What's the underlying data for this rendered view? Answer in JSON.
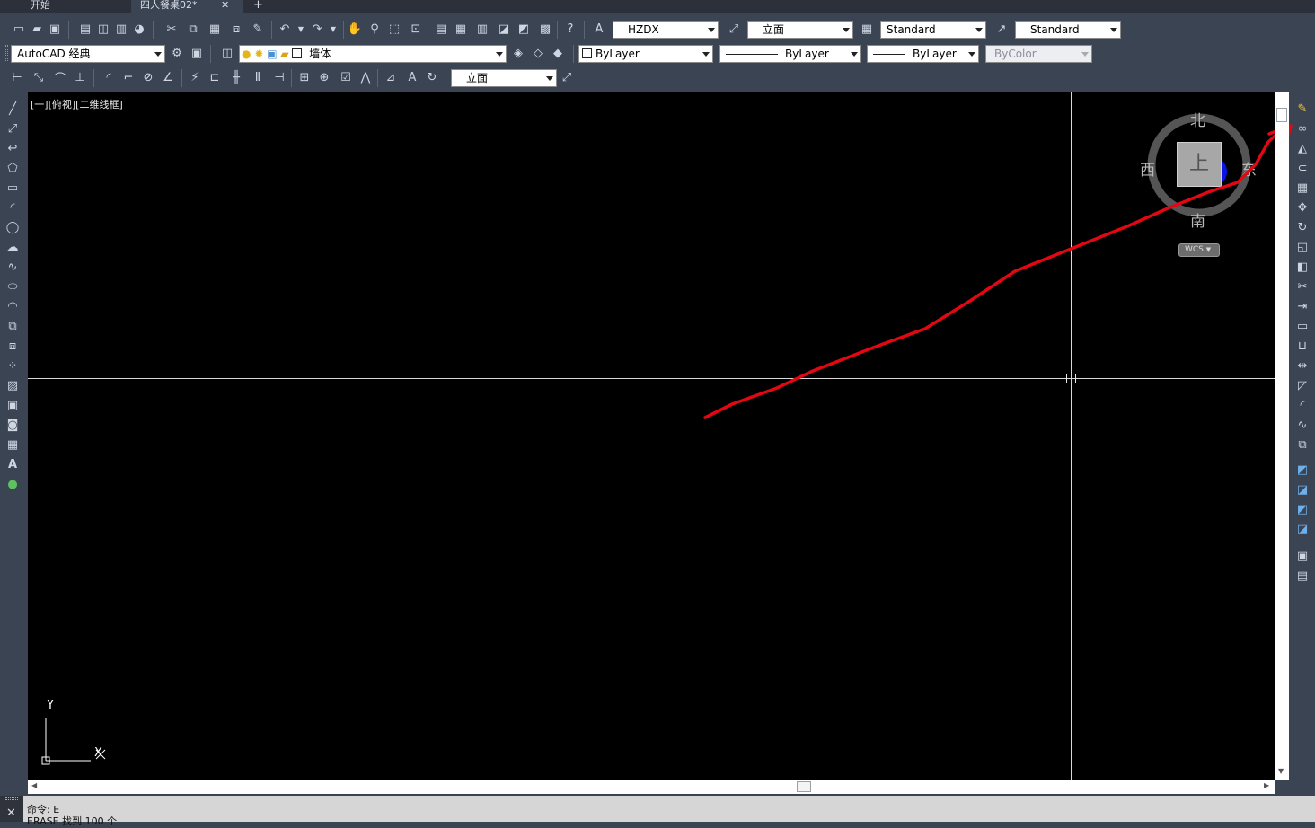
{
  "tabs": [
    {
      "label": "开始"
    },
    {
      "label": "四人餐桌02*"
    }
  ],
  "tab_close": "✕",
  "tab_add": "+",
  "toolbar": {
    "text_style": "HZDX",
    "dim_style": "立面",
    "table_style": "Standard",
    "mleader_style": "Standard",
    "workspace": "AutoCAD 经典",
    "layer": "墙体",
    "color": "ByLayer",
    "linetype": "ByLayer",
    "lineweight": "ByLayer",
    "plot_style": "ByColor",
    "view_style": "立面"
  },
  "canvas": {
    "viewport_label": "[一][俯视][二维线框]",
    "ucs_x": "X",
    "ucs_y": "Y"
  },
  "viewcube": {
    "north": "北",
    "south": "南",
    "east": "东",
    "west": "西",
    "top": "上",
    "wcs": "WCS"
  },
  "command": {
    "line1": "命令: E",
    "line2": "ERASE 找到 100 个"
  },
  "annotation": {
    "color": "#e30613"
  }
}
